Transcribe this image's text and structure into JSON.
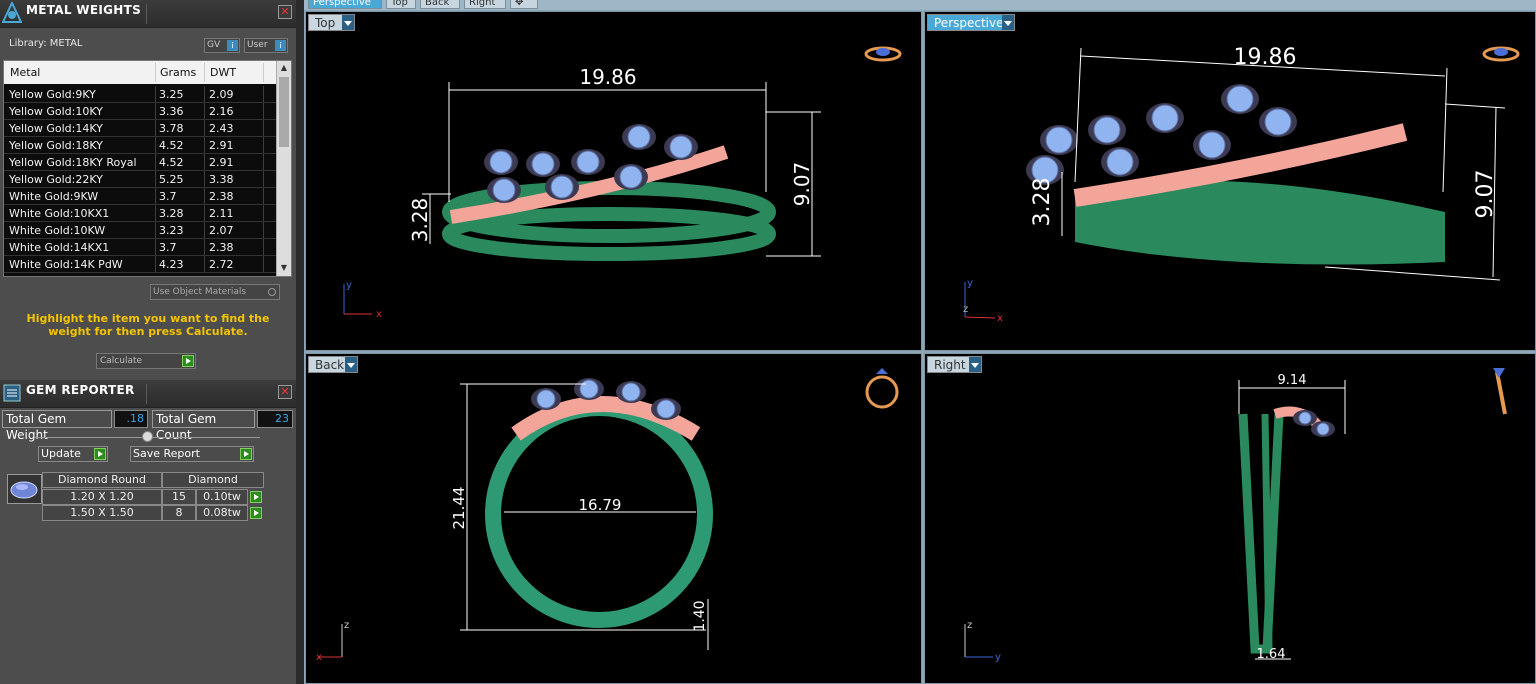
{
  "metal_panel": {
    "title": "METAL WEIGHTS",
    "library_label": "Library: METAL",
    "gv_label": "GV",
    "user_label": "User",
    "columns": [
      "Metal",
      "Grams",
      "DWT"
    ],
    "rows": [
      {
        "metal": "Yellow Gold:9KY",
        "grams": "3.25",
        "dwt": "2.09"
      },
      {
        "metal": "Yellow Gold:10KY",
        "grams": "3.36",
        "dwt": "2.16"
      },
      {
        "metal": "Yellow Gold:14KY",
        "grams": "3.78",
        "dwt": "2.43"
      },
      {
        "metal": "Yellow Gold:18KY",
        "grams": "4.52",
        "dwt": "2.91"
      },
      {
        "metal": "Yellow Gold:18KY Royal",
        "grams": "4.52",
        "dwt": "2.91"
      },
      {
        "metal": "Yellow Gold:22KY",
        "grams": "5.25",
        "dwt": "3.38"
      },
      {
        "metal": "White Gold:9KW",
        "grams": "3.7",
        "dwt": "2.38"
      },
      {
        "metal": "White Gold:10KX1",
        "grams": "3.28",
        "dwt": "2.11"
      },
      {
        "metal": "White Gold:10KW",
        "grams": "3.23",
        "dwt": "2.07"
      },
      {
        "metal": "White Gold:14KX1",
        "grams": "3.7",
        "dwt": "2.38"
      },
      {
        "metal": "White Gold:14K PdW",
        "grams": "4.23",
        "dwt": "2.72"
      }
    ],
    "use_object_materials": "Use Object Materials",
    "hint": "Highlight the item you want to find the weight for then press Calculate.",
    "calculate_label": "Calculate"
  },
  "gem_panel": {
    "title": "GEM REPORTER",
    "total_weight_label": "Total Gem Weight",
    "total_weight_value": ".18",
    "total_count_label": "Total Gem Count",
    "total_count_value": "23",
    "update_label": "Update",
    "save_report_label": "Save Report",
    "shape_header": "Diamond Round",
    "type_header": "Diamond",
    "gems": [
      {
        "size": "1.20 X 1.20",
        "count": "15",
        "weight": "0.10tw"
      },
      {
        "size": "1.50 X 1.50",
        "count": "8",
        "weight": "0.08tw"
      }
    ]
  },
  "tabs": [
    "Perspective",
    "Top",
    "Back",
    "Right"
  ],
  "viewports": {
    "top": {
      "label": "Top",
      "dims": [
        "19.86",
        "9.07",
        "3.28"
      ]
    },
    "perspective": {
      "label": "Perspective",
      "dims": [
        "19.86",
        "9.07",
        "3.28"
      ]
    },
    "back": {
      "label": "Back",
      "dims": [
        "21.44",
        "16.79",
        "1.40"
      ]
    },
    "right": {
      "label": "Right",
      "dims": [
        "9.14",
        "1.64"
      ]
    }
  },
  "colors": {
    "band": "#2a8a5e",
    "gem": "#7fa6e6",
    "accent_blue": "#4aa8d6",
    "hint": "#f5c400"
  }
}
